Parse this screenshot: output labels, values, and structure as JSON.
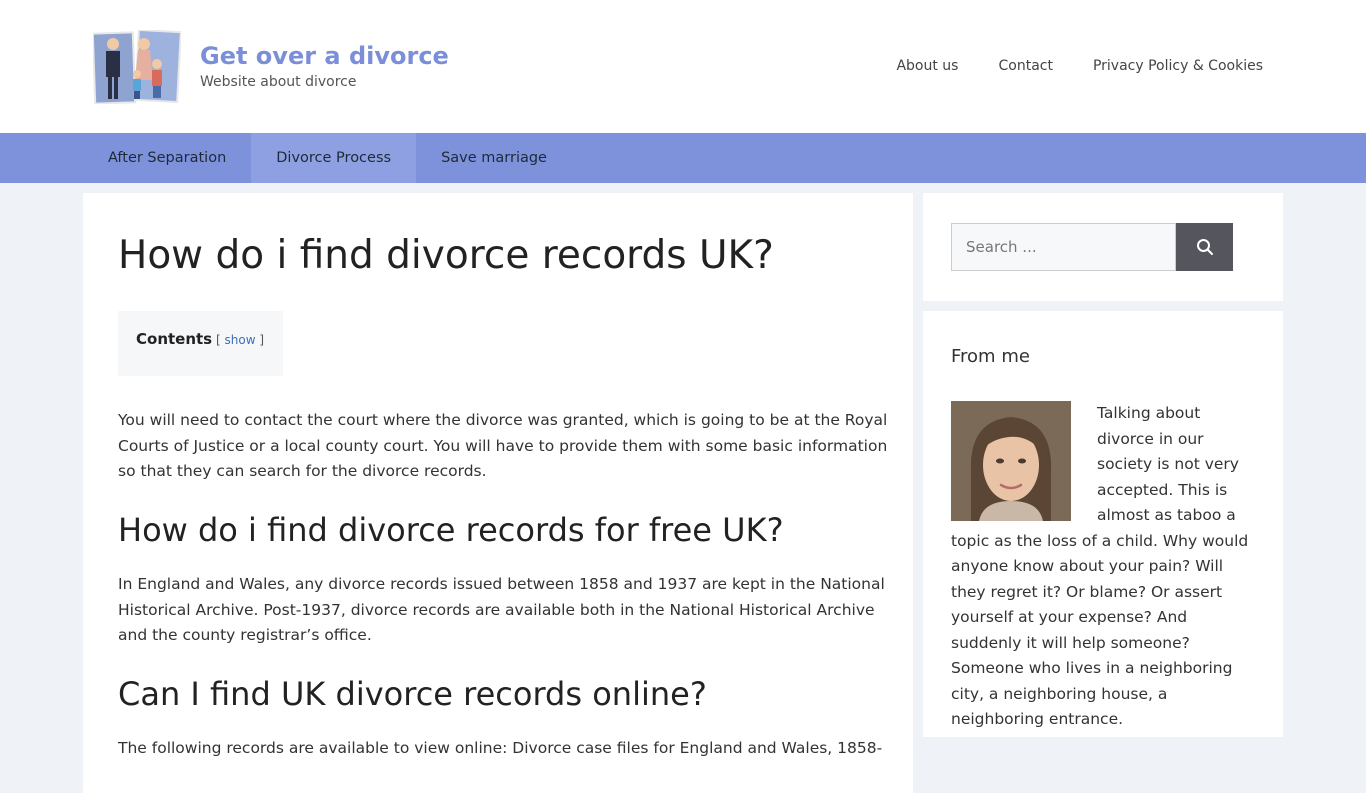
{
  "header": {
    "site_title": "Get over a divorce",
    "site_tagline": "Website about divorce",
    "nav": [
      "About us",
      "Contact",
      "Privacy Policy & Cookies"
    ]
  },
  "main_nav": {
    "items": [
      "After Separation",
      "Divorce Process",
      "Save marriage"
    ],
    "active_index": 1
  },
  "article": {
    "title": "How do i find divorce records UK?",
    "toc": {
      "title": "Contents",
      "open_bracket": "[",
      "toggle_label": "show",
      "close_bracket": "]"
    },
    "p1": "You will need to contact the court where the divorce was granted, which is going to be at the Royal Courts of Justice or a local county court. You will have to provide them with some basic information so that they can search for the divorce records.",
    "h2_1": "How do i find divorce records for free UK?",
    "p2": "In England and Wales, any divorce records issued between 1858 and 1937 are kept in the National Historical Archive. Post-1937, divorce records are available both in the National Historical Archive and the county registrar’s office.",
    "h2_2": "Can I find UK divorce records online?",
    "p3": "The following records are available to view online: Divorce case files for England and Wales, 1858-"
  },
  "sidebar": {
    "search": {
      "placeholder": "Search ...",
      "button_icon": "search-icon"
    },
    "about": {
      "title": "From me",
      "text": "Talking about divorce in our society is not very accepted. This is almost as taboo a topic as the loss of a child. Why would anyone know about your pain? Will they regret it? Or blame? Or assert yourself at your expense? And suddenly it will help someone? Someone who lives in a neighboring city, a neighboring house, a neighboring entrance."
    }
  },
  "colors": {
    "accent": "#7e92dc",
    "title": "#7b8fd8",
    "link": "#3b6fb8",
    "search_button": "#55555e"
  }
}
